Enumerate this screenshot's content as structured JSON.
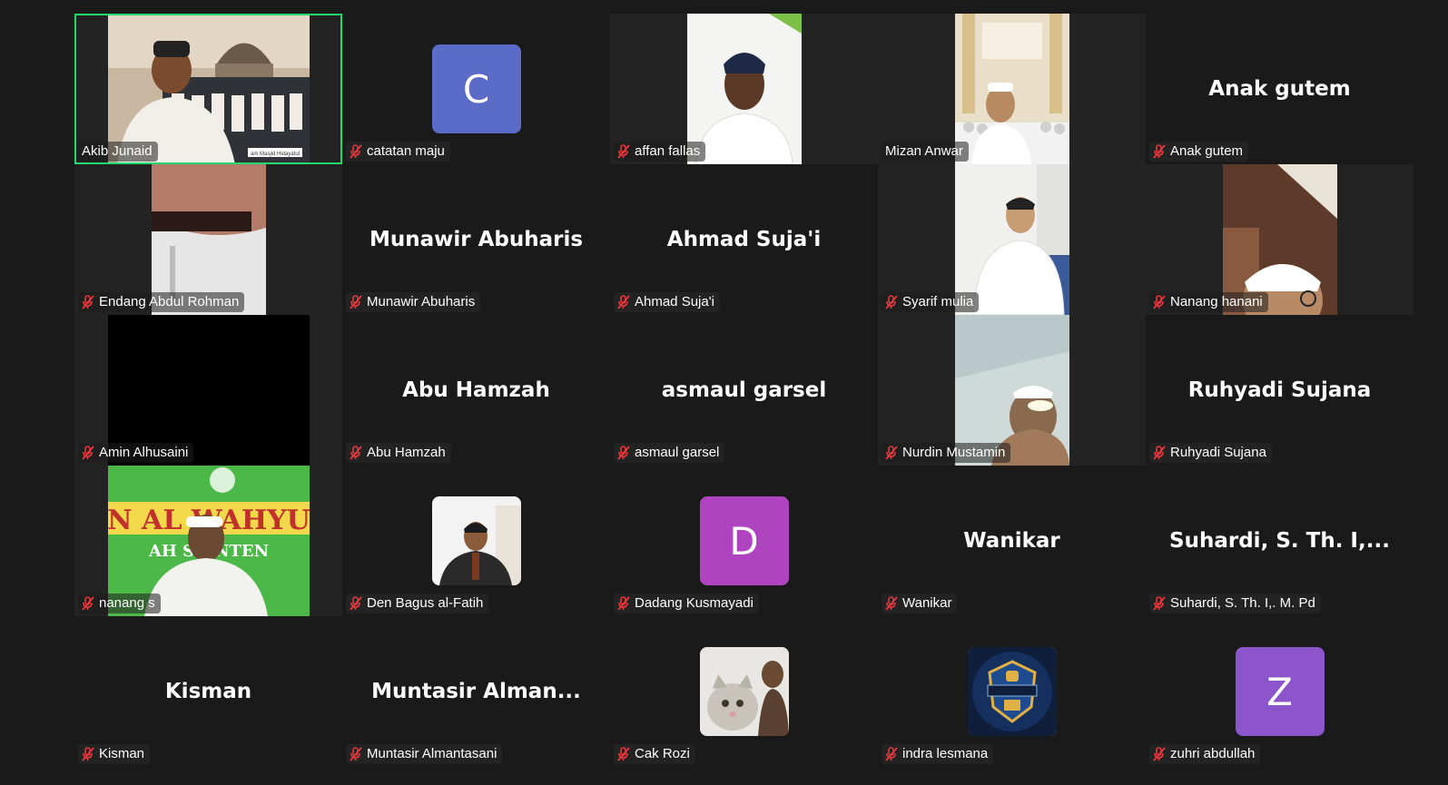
{
  "participants": [
    {
      "name": "Akib Junaid",
      "display": "",
      "video": "akib",
      "avatar_letter": "",
      "avatar_color": "",
      "muted": false,
      "active": true
    },
    {
      "name": "catatan maju",
      "display": "",
      "video": "",
      "avatar_letter": "C",
      "avatar_color": "#5b6bc8",
      "muted": true,
      "active": false
    },
    {
      "name": "affan fallas",
      "display": "",
      "video": "affan",
      "avatar_letter": "",
      "avatar_color": "",
      "muted": true,
      "active": false
    },
    {
      "name": "Mizan Anwar",
      "display": "",
      "video": "mizan",
      "avatar_letter": "",
      "avatar_color": "",
      "muted": false,
      "active": false
    },
    {
      "name": "Anak gutem",
      "display": "Anak gutem",
      "video": "",
      "avatar_letter": "",
      "avatar_color": "",
      "muted": true,
      "active": false
    },
    {
      "name": "Endang Abdul Rohman",
      "display": "",
      "video": "endang",
      "avatar_letter": "",
      "avatar_color": "",
      "muted": true,
      "active": false
    },
    {
      "name": "Munawir Abuharis",
      "display": "Munawir Abuharis",
      "video": "",
      "avatar_letter": "",
      "avatar_color": "",
      "muted": true,
      "active": false
    },
    {
      "name": "Ahmad Suja'i",
      "display": "Ahmad Suja'i",
      "video": "",
      "avatar_letter": "",
      "avatar_color": "",
      "muted": true,
      "active": false
    },
    {
      "name": "Syarif mulia",
      "display": "",
      "video": "syarif",
      "avatar_letter": "",
      "avatar_color": "",
      "muted": true,
      "active": false
    },
    {
      "name": "Nanang hanani",
      "display": "",
      "video": "nanang_h",
      "avatar_letter": "",
      "avatar_color": "",
      "muted": true,
      "active": false
    },
    {
      "name": "Amin Alhusaini",
      "display": "",
      "video": "amin",
      "avatar_letter": "",
      "avatar_color": "",
      "muted": true,
      "active": false
    },
    {
      "name": "Abu Hamzah",
      "display": "Abu Hamzah",
      "video": "",
      "avatar_letter": "",
      "avatar_color": "",
      "muted": true,
      "active": false
    },
    {
      "name": "asmaul garsel",
      "display": "asmaul garsel",
      "video": "",
      "avatar_letter": "",
      "avatar_color": "",
      "muted": true,
      "active": false
    },
    {
      "name": "Nurdin Mustamin",
      "display": "",
      "video": "nurdin",
      "avatar_letter": "",
      "avatar_color": "",
      "muted": true,
      "active": false
    },
    {
      "name": "Ruhyadi Sujana",
      "display": "Ruhyadi Sujana",
      "video": "",
      "avatar_letter": "",
      "avatar_color": "",
      "muted": true,
      "active": false
    },
    {
      "name": "nanang s",
      "display": "",
      "video": "nanang_s",
      "avatar_letter": "",
      "avatar_color": "",
      "muted": true,
      "active": false
    },
    {
      "name": "Den Bagus al-Fatih",
      "display": "",
      "video": "",
      "avatar_letter": "",
      "avatar_color": "",
      "avatar_photo": "den",
      "muted": true,
      "active": false
    },
    {
      "name": "Dadang Kusmayadi",
      "display": "",
      "video": "",
      "avatar_letter": "D",
      "avatar_color": "#b044c0",
      "muted": true,
      "active": false
    },
    {
      "name": "Wanikar",
      "display": "Wanikar",
      "video": "",
      "avatar_letter": "",
      "avatar_color": "",
      "muted": true,
      "active": false
    },
    {
      "name": "Suhardi, S. Th. I,. M. Pd",
      "display": "Suhardi, S. Th. I,...",
      "video": "",
      "avatar_letter": "",
      "avatar_color": "",
      "muted": true,
      "active": false
    },
    {
      "name": "Kisman",
      "display": "Kisman",
      "video": "",
      "avatar_letter": "",
      "avatar_color": "",
      "muted": true,
      "active": false
    },
    {
      "name": "Muntasir Almantasani",
      "display": "Muntasir  Alman...",
      "video": "",
      "avatar_letter": "",
      "avatar_color": "",
      "muted": true,
      "active": false
    },
    {
      "name": "Cak Rozi",
      "display": "",
      "video": "",
      "avatar_letter": "",
      "avatar_color": "",
      "avatar_photo": "cat",
      "muted": true,
      "active": false
    },
    {
      "name": "indra lesmana",
      "display": "",
      "video": "",
      "avatar_letter": "",
      "avatar_color": "",
      "avatar_photo": "badge",
      "muted": true,
      "active": false
    },
    {
      "name": "zuhri abdullah",
      "display": "",
      "video": "",
      "avatar_letter": "Z",
      "avatar_color": "#8c55cc",
      "muted": true,
      "active": false
    }
  ],
  "banner_text": {
    "akib": "am Masjid Hidayatul",
    "nanang_s": "N AL WAHYU",
    "nanang_s2": "AH SU    NTEN"
  },
  "colors": {
    "active_border": "#23d96e",
    "muted_icon": "#e8383d",
    "background": "#1a1a1a"
  }
}
